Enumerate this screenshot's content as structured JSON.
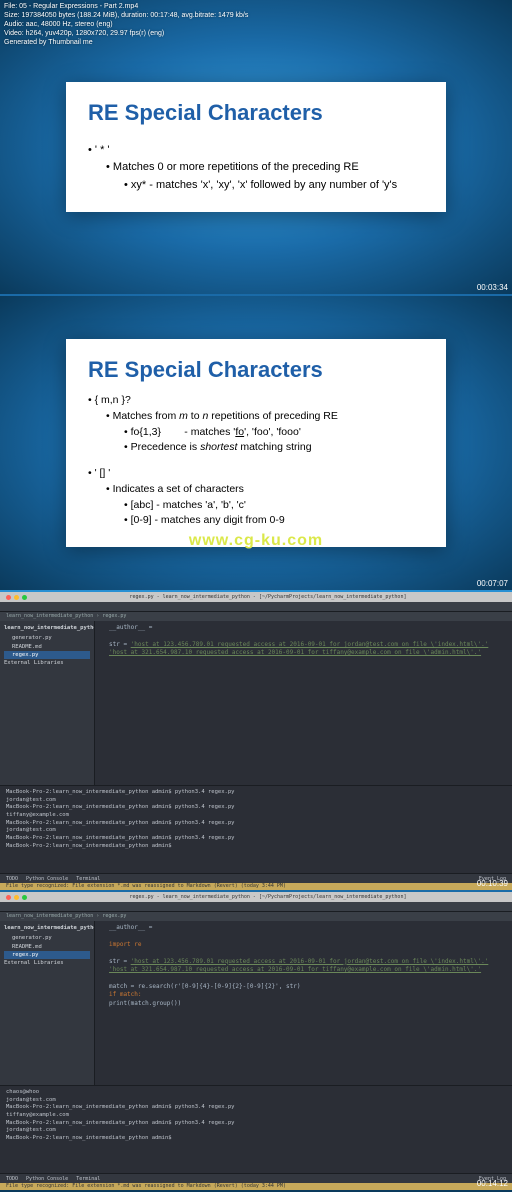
{
  "meta": {
    "file": "File: 05 - Regular Expressions - Part 2.mp4",
    "size": "Size: 197384050 bytes (188.24 MiB), duration: 00:17:48, avg.bitrate: 1479 kb/s",
    "audio": "Audio: aac, 48000 Hz, stereo (eng)",
    "video": "Video: h264, yuv420p, 1280x720, 29.97 fps(r) (eng)",
    "generated": "Generated by Thumbnail me"
  },
  "timestamps": {
    "f1": "00:03:34",
    "f2": "00:07:07",
    "f3": "00:10:39",
    "f4": "00:14:12"
  },
  "watermark": "www.cg-ku.com",
  "slide1": {
    "title": "RE  Special Characters",
    "b1": "' * '",
    "b2": "Matches 0 or more repetitions of the preceding RE",
    "b3": "xy*   - matches 'x', 'xy', 'x' followed by any number of 'y's"
  },
  "slide2": {
    "title": "RE  Special Characters",
    "b1": "{ m,n }?",
    "b2": "Matches from m to n repetitions of preceding RE",
    "b3": "fo{1,3}        - matches 'fo', 'foo', 'fooo'",
    "b4": "Precedence is shortest matching string",
    "b5": "' [] '",
    "b6": "Indicates a set of characters",
    "b7": "[abc]          - matches 'a', 'b', 'c'",
    "b8": "[0-9]          - matches any digit from 0-9"
  },
  "ide": {
    "title": "regex.py - learn_now_intermediate_python - [~/PycharmProjects/learn_now_intermediate_python]",
    "project": "learn_now_intermediate_python",
    "crumbs": "learn_now_intermediate_python › regex.py",
    "files": {
      "f1": "generator.py",
      "f2": "README.md",
      "f3": "regex.py"
    },
    "lib": "External Libraries",
    "author_line": "__author__ = ",
    "import_line": "import re",
    "str_var": "str = ",
    "str1": "'host at 123.456.789.01 requested access at 2016-09-01 for jordan@test.com on file \\'index.html\\'.'",
    "str2": "'host at 321.654.987.10 requested access at 2016-09-01 for tiffany@example.com on file \\'admin.html\\'.'",
    "code_match": "match = re.search(r'[0-9]{4}-[0-9]{2}-[0-9]{2}', str)",
    "code_if": "if match:",
    "code_print": "    print(match.group())",
    "terminal": {
      "l1": "MacBook-Pro-2:learn_now_intermediate_python admin$ python3.4 regex.py",
      "l2": "jordan@test.com",
      "l3": "MacBook-Pro-2:learn_now_intermediate_python admin$ python3.4 regex.py",
      "l4": "tiffany@example.com",
      "l5": "MacBook-Pro-2:learn_now_intermediate_python admin$ python3.4 regex.py",
      "l6": "jordan@test.com",
      "l7": "MacBook-Pro-2:learn_now_intermediate_python admin$ python3.4 regex.py",
      "l8": "MacBook-Pro-2:learn_now_intermediate_python admin$",
      "t2_l1": "chaos@whoo",
      "t2_l2": "jordan@test.com",
      "t2_l3": "tiffany@example.com"
    },
    "status": {
      "todo": "TODO",
      "pyconsole": "Python Console",
      "terminal": "Terminal",
      "eventlog": "Event Log"
    },
    "infobar": "File type recognized: File extension *.md was reassigned to Markdown (Revert) (today 3:44 PM)"
  }
}
